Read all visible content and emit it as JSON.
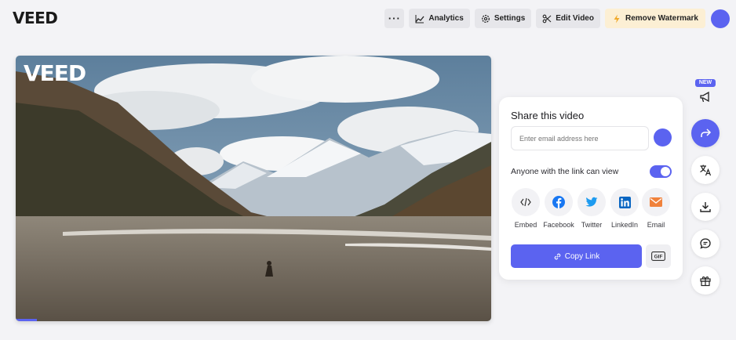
{
  "app": {
    "logo": "VEED"
  },
  "toolbar": {
    "more_label": "···",
    "analytics_label": "Analytics",
    "settings_label": "Settings",
    "edit_label": "Edit Video",
    "watermark_label": "Remove Watermark"
  },
  "video": {
    "watermark": "VEED",
    "progress": 0.045
  },
  "share": {
    "title": "Share this video",
    "email_placeholder": "Enter email address here",
    "link_access": "Anyone with the link can view",
    "link_enabled": true,
    "targets": [
      {
        "label": "Embed",
        "icon": "embed-icon"
      },
      {
        "label": "Facebook",
        "icon": "facebook-icon",
        "color": "#1877f2"
      },
      {
        "label": "Twitter",
        "icon": "twitter-icon",
        "color": "#1d9bf0"
      },
      {
        "label": "LinkedIn",
        "icon": "linkedin-icon",
        "color": "#0a66c2"
      },
      {
        "label": "Email",
        "icon": "email-icon",
        "color": "#f0823c"
      }
    ],
    "copy_label": "Copy Link",
    "gif_label": "GIF"
  },
  "sidebar": {
    "new_badge": "NEW",
    "buttons": [
      "megaphone-icon",
      "share-icon",
      "translate-icon",
      "download-icon",
      "comment-icon",
      "gift-icon"
    ]
  },
  "colors": {
    "accent": "#5b63f0",
    "watermark_bg": "#fcefd4",
    "background": "#f3f3f6"
  }
}
